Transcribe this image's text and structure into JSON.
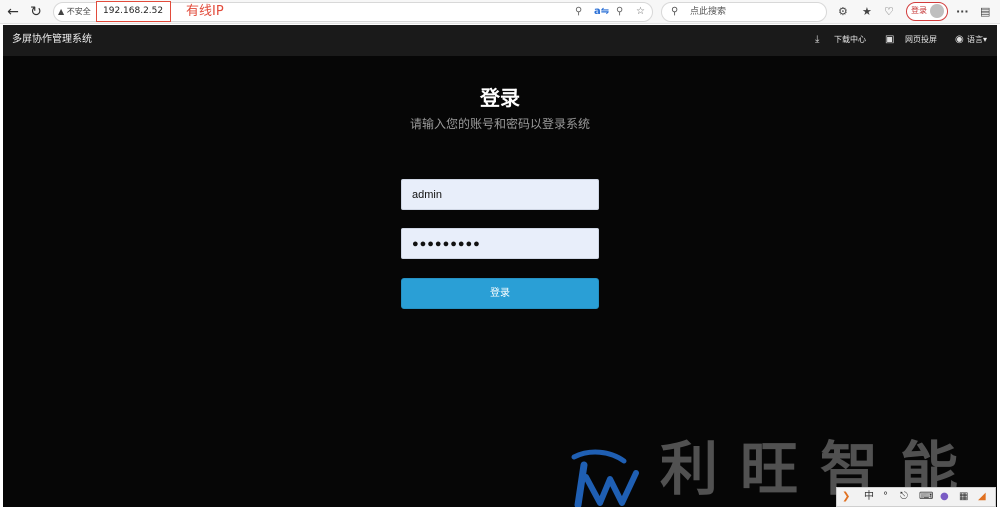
{
  "browser": {
    "back_icon": "back-arrow-icon",
    "reload_icon": "reload-icon",
    "security_label": "不安全",
    "url": "192.168.2.52",
    "annotation": "有线IP",
    "search_placeholder": "点此搜索",
    "profile_label": "登录",
    "more_label": "···"
  },
  "header": {
    "title": "多屏协作管理系统",
    "download_label": "下载中心",
    "cast_label": "网页投屏",
    "language_label": "语言"
  },
  "login": {
    "title": "登录",
    "subtitle": "请输入您的账号和密码以登录系统",
    "username_value": "admin",
    "password_value": "●●●●●●●●●",
    "submit_label": "登录"
  },
  "watermark": {
    "text": "利旺智能",
    "color": "#1f5fb3"
  },
  "ime": {
    "mode_label": "中"
  },
  "colors": {
    "accent": "#2a9fd6",
    "background": "#060606",
    "header": "#1a1a1a",
    "highlight": "#e24b3b"
  }
}
